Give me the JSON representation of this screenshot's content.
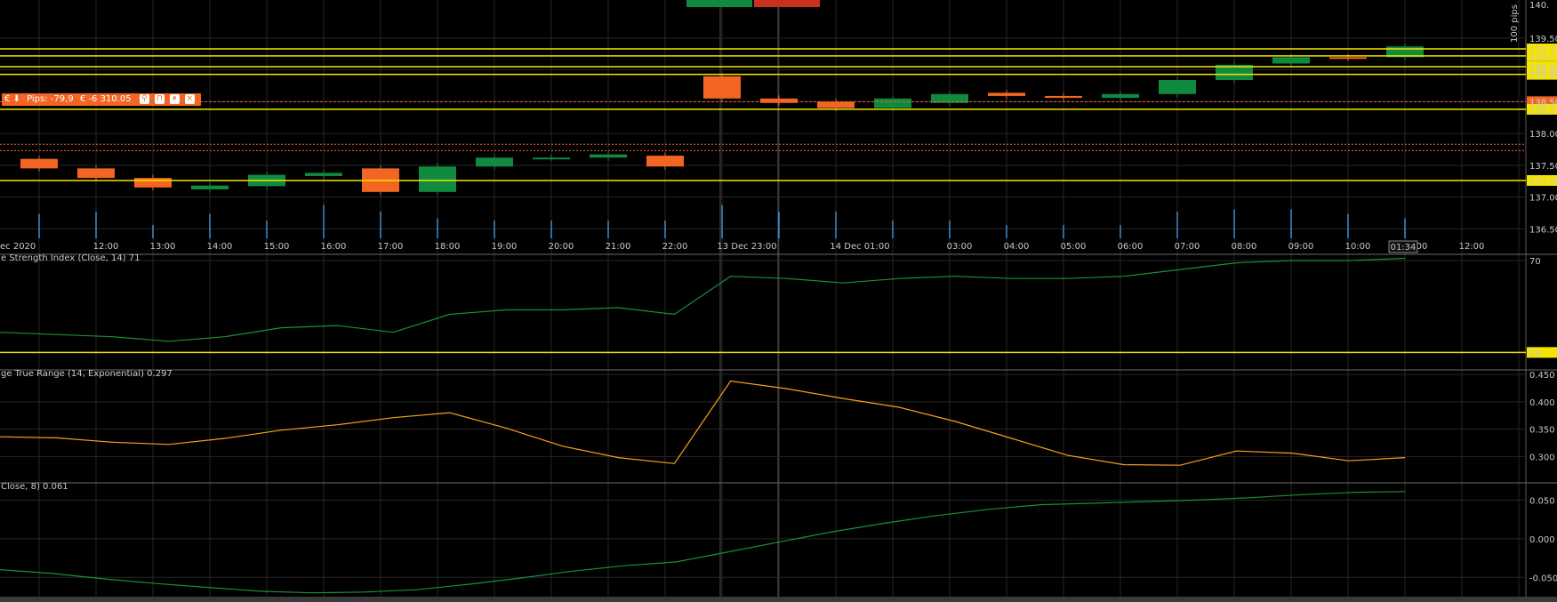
{
  "colors": {
    "bull": "#0f8a3f",
    "bear": "#f26522",
    "yellow_line": "#f5e400",
    "grid": "#262626",
    "rsi": "#1b8f3a",
    "atr": "#f5a21a",
    "roc": "#1b8f3a",
    "price_tag_bg": "#f5e400",
    "price_tag_text": "#000000",
    "current_tag_bg": "#f26522"
  },
  "header": {
    "pips_scale": "100 pips",
    "top_tag_left": "",
    "top_tag_right": ""
  },
  "position": {
    "pips": "Pips: -79,9",
    "pnl": "€ -6 310.05",
    "btn1": "⚲",
    "btn2": "⊓",
    "btn3": "⏸",
    "btn4": "×",
    "prefix": "€ ⬇"
  },
  "chart_data": [
    {
      "type": "candlestick",
      "panel": "price",
      "x_labels": [
        "ec 2020",
        "12:00",
        "13:00",
        "14:00",
        "15:00",
        "16:00",
        "17:00",
        "18:00",
        "19:00",
        "20:00",
        "21:00",
        "22:00",
        "13 Dec 23:00",
        "14 Dec 01:00",
        "03:00",
        "04:00",
        "05:00",
        "06:00",
        "07:00",
        "08:00",
        "09:00",
        "10:00",
        "11:00",
        "12:00"
      ],
      "y_ticks": [
        "139.50",
        "139.00",
        "138.50",
        "138.00",
        "137.50",
        "137.00",
        "136.50"
      ],
      "ylim": [
        136.35,
        140.1
      ],
      "top_tick": "140.",
      "candles": [
        {
          "o": 137.6,
          "c": 137.45
        },
        {
          "o": 137.45,
          "c": 137.3
        },
        {
          "o": 137.3,
          "c": 137.15
        },
        {
          "o": 137.12,
          "c": 137.18
        },
        {
          "o": 137.17,
          "c": 137.35
        },
        {
          "o": 137.33,
          "c": 137.38
        },
        {
          "o": 137.45,
          "c": 137.08
        },
        {
          "o": 137.08,
          "c": 137.48
        },
        {
          "o": 137.48,
          "c": 137.62
        },
        {
          "o": 137.61,
          "c": 137.62
        },
        {
          "o": 137.62,
          "c": 137.67
        },
        {
          "o": 137.65,
          "c": 137.48
        },
        {
          "o": 138.9,
          "c": 138.55
        },
        {
          "o": 138.55,
          "c": 138.48
        },
        {
          "o": 138.5,
          "c": 138.4
        },
        {
          "o": 138.4,
          "c": 138.55
        },
        {
          "o": 138.48,
          "c": 138.62
        },
        {
          "o": 138.64,
          "c": 138.59
        },
        {
          "o": 138.59,
          "c": 138.56
        },
        {
          "o": 138.56,
          "c": 138.62
        },
        {
          "o": 138.62,
          "c": 138.84
        },
        {
          "o": 138.84,
          "c": 139.08
        },
        {
          "o": 139.1,
          "c": 139.2
        },
        {
          "o": 139.2,
          "c": 139.19
        },
        {
          "o": 139.2,
          "c": 139.37
        }
      ],
      "horizontal_levels": [
        {
          "value": 139.33,
          "label": "139.3"
        },
        {
          "value": 139.22,
          "label": "139.2"
        },
        {
          "value": 139.05,
          "label": "139.0"
        },
        {
          "value": 138.93,
          "label": "138.93"
        },
        {
          "value": 138.5,
          "label": "138.50",
          "current": true
        },
        {
          "value": 138.38,
          "label": "138.3"
        },
        {
          "value": 137.26,
          "label": "137.26"
        }
      ],
      "volume_ticks": [
        0.55,
        0.6,
        0.3,
        0.55,
        0.4,
        0.75,
        0.6,
        0.45,
        0.4,
        0.4,
        0.4,
        0.4,
        0.75,
        0.6,
        0.6,
        0.4,
        0.4,
        0.3,
        0.3,
        0.3,
        0.6,
        0.65,
        0.65,
        0.55,
        0.45
      ],
      "current_time_label": "01:34"
    },
    {
      "type": "line",
      "panel": "rsi",
      "title": "e Strength Index (Close, 14) 71",
      "y_ticks": [
        "70",
        "29"
      ],
      "ylim": [
        22,
        72
      ],
      "values": [
        38,
        37,
        36,
        34,
        36,
        40,
        41,
        38,
        46,
        48,
        48,
        49,
        46,
        63,
        62,
        60,
        62,
        63,
        62,
        62,
        63,
        66,
        69,
        70,
        70,
        71
      ],
      "level": 29
    },
    {
      "type": "line",
      "panel": "atr",
      "title": "ge True Range (14, Exponential) 0.297",
      "y_ticks": [
        "0.450",
        "0.400",
        "0.350",
        "0.300"
      ],
      "ylim": [
        0.255,
        0.455
      ],
      "values": [
        0.336,
        0.334,
        0.326,
        0.322,
        0.333,
        0.348,
        0.358,
        0.371,
        0.38,
        0.352,
        0.319,
        0.298,
        0.287,
        0.438,
        0.424,
        0.406,
        0.39,
        0.364,
        0.333,
        0.302,
        0.285,
        0.284,
        0.31,
        0.306,
        0.292,
        0.298
      ]
    },
    {
      "type": "line",
      "panel": "roc",
      "title": "Close, 8) 0.061",
      "y_ticks": [
        "0.050",
        "0.000",
        "-0.050"
      ],
      "ylim": [
        -0.075,
        0.07
      ],
      "values": [
        -0.04,
        -0.045,
        -0.052,
        -0.058,
        -0.063,
        -0.068,
        -0.07,
        -0.069,
        -0.066,
        -0.059,
        -0.051,
        -0.042,
        -0.035,
        -0.03,
        -0.017,
        -0.004,
        0.009,
        0.02,
        0.03,
        0.038,
        0.044,
        0.046,
        0.048,
        0.05,
        0.053,
        0.057,
        0.06,
        0.061
      ]
    }
  ]
}
